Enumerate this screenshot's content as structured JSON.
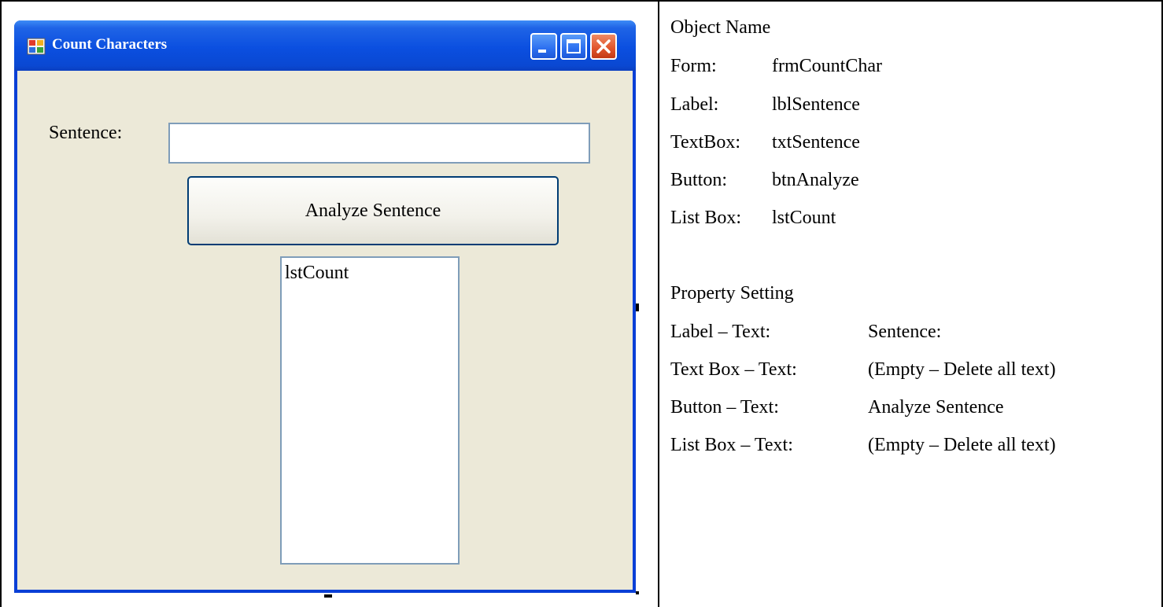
{
  "window": {
    "title": "Count Characters",
    "colors": {
      "titlebar": "#0a48d2",
      "client": "#ece9d8",
      "close": "#e0532a"
    }
  },
  "form": {
    "label": "Sentence:",
    "textbox_value": "",
    "button_label": "Analyze Sentence",
    "listbox_items": [
      "lstCount"
    ]
  },
  "object_names": {
    "heading": "Object Name",
    "rows": [
      {
        "type": "Form:",
        "name": "frmCountChar"
      },
      {
        "type": "Label:",
        "name": "lblSentence"
      },
      {
        "type": "TextBox:",
        "name": "txtSentence"
      },
      {
        "type": "Button:",
        "name": "btnAnalyze"
      },
      {
        "type": "List Box:",
        "name": "lstCount"
      }
    ]
  },
  "property_settings": {
    "heading": "Property Setting",
    "rows": [
      {
        "property": "Label – Text:",
        "value": "Sentence:"
      },
      {
        "property": "Text Box – Text:",
        "value": "(Empty – Delete all text)"
      },
      {
        "property": "Button – Text:",
        "value": "Analyze Sentence"
      },
      {
        "property": "List Box – Text:",
        "value": "(Empty – Delete all text)"
      }
    ]
  }
}
